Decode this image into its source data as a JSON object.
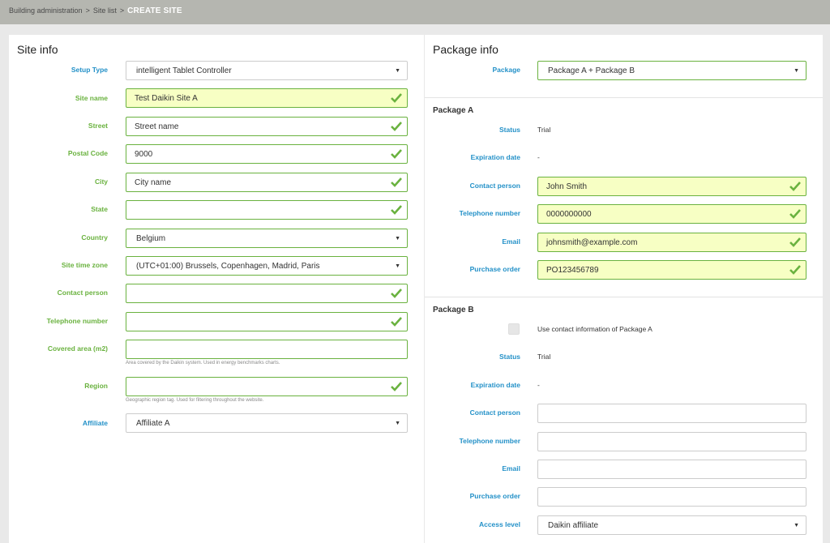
{
  "breadcrumb": {
    "item1": "Building administration",
    "item2": "Site list",
    "sep": ">",
    "current": "CREATE SITE"
  },
  "site_info": {
    "title": "Site info",
    "fields": [
      {
        "label": "Setup Type",
        "value": "intelligent Tablet Controller",
        "kind": "select"
      },
      {
        "label": "Site name",
        "value": "Test Daikin Site A",
        "kind": "text"
      },
      {
        "label": "Street",
        "value": "Street name",
        "kind": "text"
      },
      {
        "label": "Postal Code",
        "value": "9000",
        "kind": "text"
      },
      {
        "label": "City",
        "value": "City name",
        "kind": "text"
      },
      {
        "label": "State",
        "value": "",
        "kind": "text"
      },
      {
        "label": "Country",
        "value": "Belgium",
        "kind": "select"
      },
      {
        "label": "Site time zone",
        "value": "(UTC+01:00) Brussels, Copenhagen, Madrid, Paris",
        "kind": "select"
      },
      {
        "label": "Contact person",
        "value": "",
        "kind": "text"
      },
      {
        "label": "Telephone number",
        "value": "",
        "kind": "text"
      },
      {
        "label": "Covered area (m2)",
        "value": "",
        "kind": "text",
        "hint": "Area covered by the Daikin system. Used in energy benchmarks charts."
      },
      {
        "label": "Region",
        "value": "",
        "kind": "text",
        "hint": "Geographic region tag. Used for filtering throughout the website."
      },
      {
        "label": "Affiliate",
        "value": "Affiliate A",
        "kind": "select"
      }
    ]
  },
  "package_info": {
    "title": "Package info",
    "package_label": "Package",
    "package_value": "Package A + Package B",
    "package_a": {
      "title": "Package A",
      "status_label": "Status",
      "status_value": "Trial",
      "expiration_label": "Expiration date",
      "expiration_value": "-",
      "contact_label": "Contact person",
      "contact_value": "John Smith",
      "phone_label": "Telephone number",
      "phone_value": "0000000000",
      "email_label": "Email",
      "email_value": "johnsmith@example.com",
      "po_label": "Purchase order",
      "po_value": "PO123456789"
    },
    "package_b": {
      "title": "Package B",
      "use_contact_label": "Use contact information of Package A",
      "status_label": "Status",
      "status_value": "Trial",
      "expiration_label": "Expiration date",
      "expiration_value": "-",
      "contact_label": "Contact person",
      "contact_value": "",
      "phone_label": "Telephone number",
      "phone_value": "",
      "email_label": "Email",
      "email_value": "",
      "po_label": "Purchase order",
      "po_value": "",
      "access_label": "Access level",
      "access_value": "Daikin affiliate"
    }
  },
  "colors": {
    "label_blue": "#2491c8",
    "label_green": "#6ab23f",
    "valid_fill": "#f7ffc4",
    "top_bar": "#b5b6b0"
  }
}
